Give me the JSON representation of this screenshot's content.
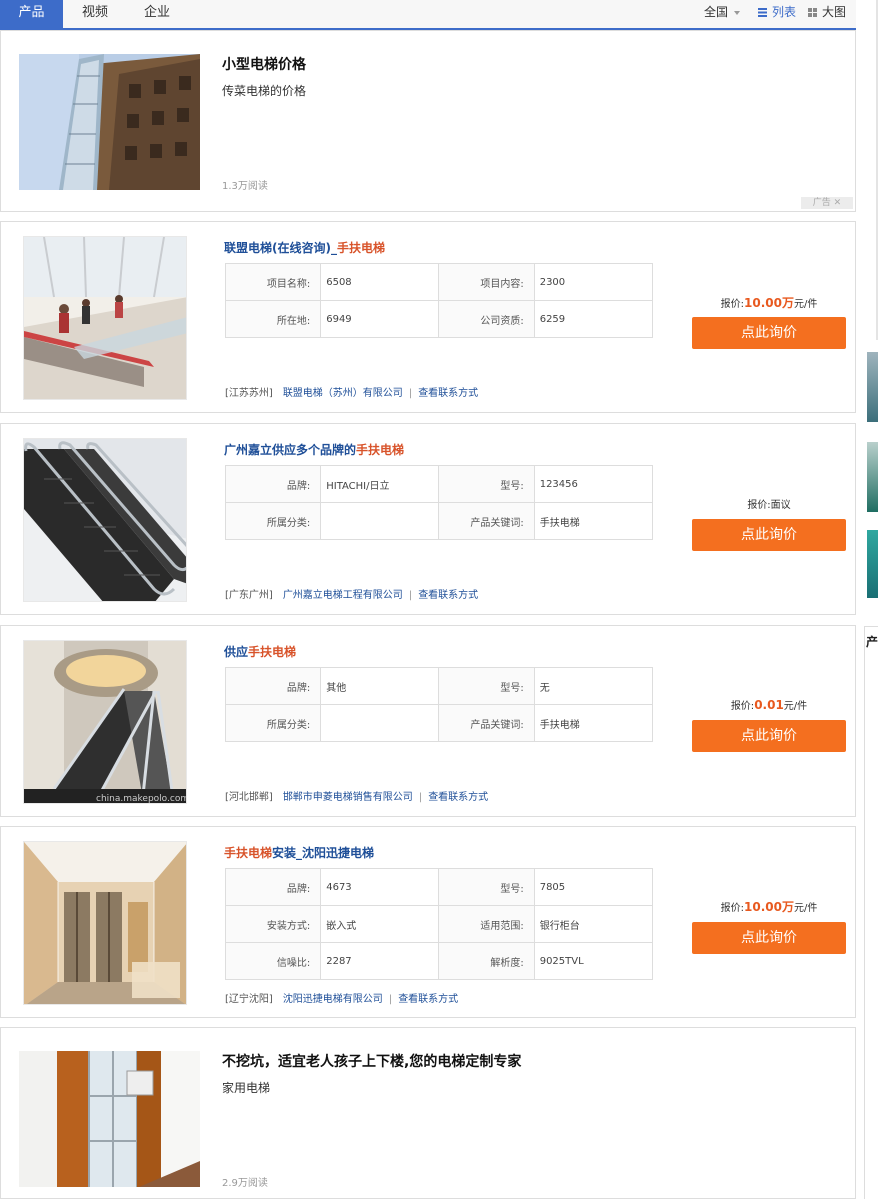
{
  "tabs": [
    {
      "label": "产品",
      "active": true
    },
    {
      "label": "视频",
      "active": false
    },
    {
      "label": "企业",
      "active": false
    }
  ],
  "toolbar": {
    "region": "全国",
    "list_label": "列表",
    "grid_label": "大图"
  },
  "ads": [
    {
      "title": "小型电梯价格",
      "desc": "传菜电梯的价格",
      "reads": "1.3万阅读",
      "ad_label": "广告"
    },
    {
      "title": "不挖坑，适宜老人孩子上下楼,您的电梯定制专家",
      "desc": "家用电梯",
      "reads": "2.9万阅读"
    }
  ],
  "products": [
    {
      "title_main": "联盟电梯(在线咨询)_",
      "title_hl": "手扶电梯",
      "specs": [
        [
          "项目名称:",
          "6508",
          "项目内容:",
          "2300"
        ],
        [
          "所在地:",
          "6949",
          "公司资质:",
          "6259"
        ]
      ],
      "location": "[江苏苏州]",
      "company": "联盟电梯（苏州）有限公司",
      "contact": "查看联系方式",
      "price_prefix": "报价:",
      "price_value": "10.00万",
      "price_unit": "元/件",
      "cta": "点此询价"
    },
    {
      "title_main": "广州嘉立供应多个品牌的",
      "title_hl": "手扶电梯",
      "specs": [
        [
          "品牌:",
          "HITACHI/日立",
          "型号:",
          "123456"
        ],
        [
          "所属分类:",
          "",
          "产品关键词:",
          "手扶电梯"
        ]
      ],
      "location": "[广东广州]",
      "company": "广州嘉立电梯工程有限公司",
      "contact": "查看联系方式",
      "price_text": "报价:面议",
      "cta": "点此询价"
    },
    {
      "title_main": "供应",
      "title_hl": "手扶电梯",
      "specs": [
        [
          "品牌:",
          "其他",
          "型号:",
          "无"
        ],
        [
          "所属分类:",
          "",
          "产品关键词:",
          "手扶电梯"
        ]
      ],
      "location": "[河北邯郸]",
      "company": "邯郸市申菱电梯销售有限公司",
      "contact": "查看联系方式",
      "price_prefix": "报价:",
      "price_value": "0.01",
      "price_unit": "元/件",
      "cta": "点此询价",
      "img_watermark": "china.makepolo.com"
    },
    {
      "title_hl": "手扶电梯",
      "title_main": "安装_沈阳迅捷电梯",
      "specs": [
        [
          "品牌:",
          "4673",
          "型号:",
          "7805"
        ],
        [
          "安装方式:",
          "嵌入式",
          "适用范围:",
          "银行柜台"
        ],
        [
          "信噪比:",
          "2287",
          "解析度:",
          "9025TVL"
        ]
      ],
      "location": "[辽宁沈阳]",
      "company": "沈阳迅捷电梯有限公司",
      "contact": "查看联系方式",
      "price_prefix": "报价:",
      "price_value": "10.00万",
      "price_unit": "元/件",
      "cta": "点此询价"
    }
  ],
  "edge_label": "产",
  "colors": {
    "accent": "#3d6cc9",
    "cta": "#f46f1f",
    "price": "#e8591f",
    "link": "#1f4f98",
    "highlight": "#d8532a"
  }
}
